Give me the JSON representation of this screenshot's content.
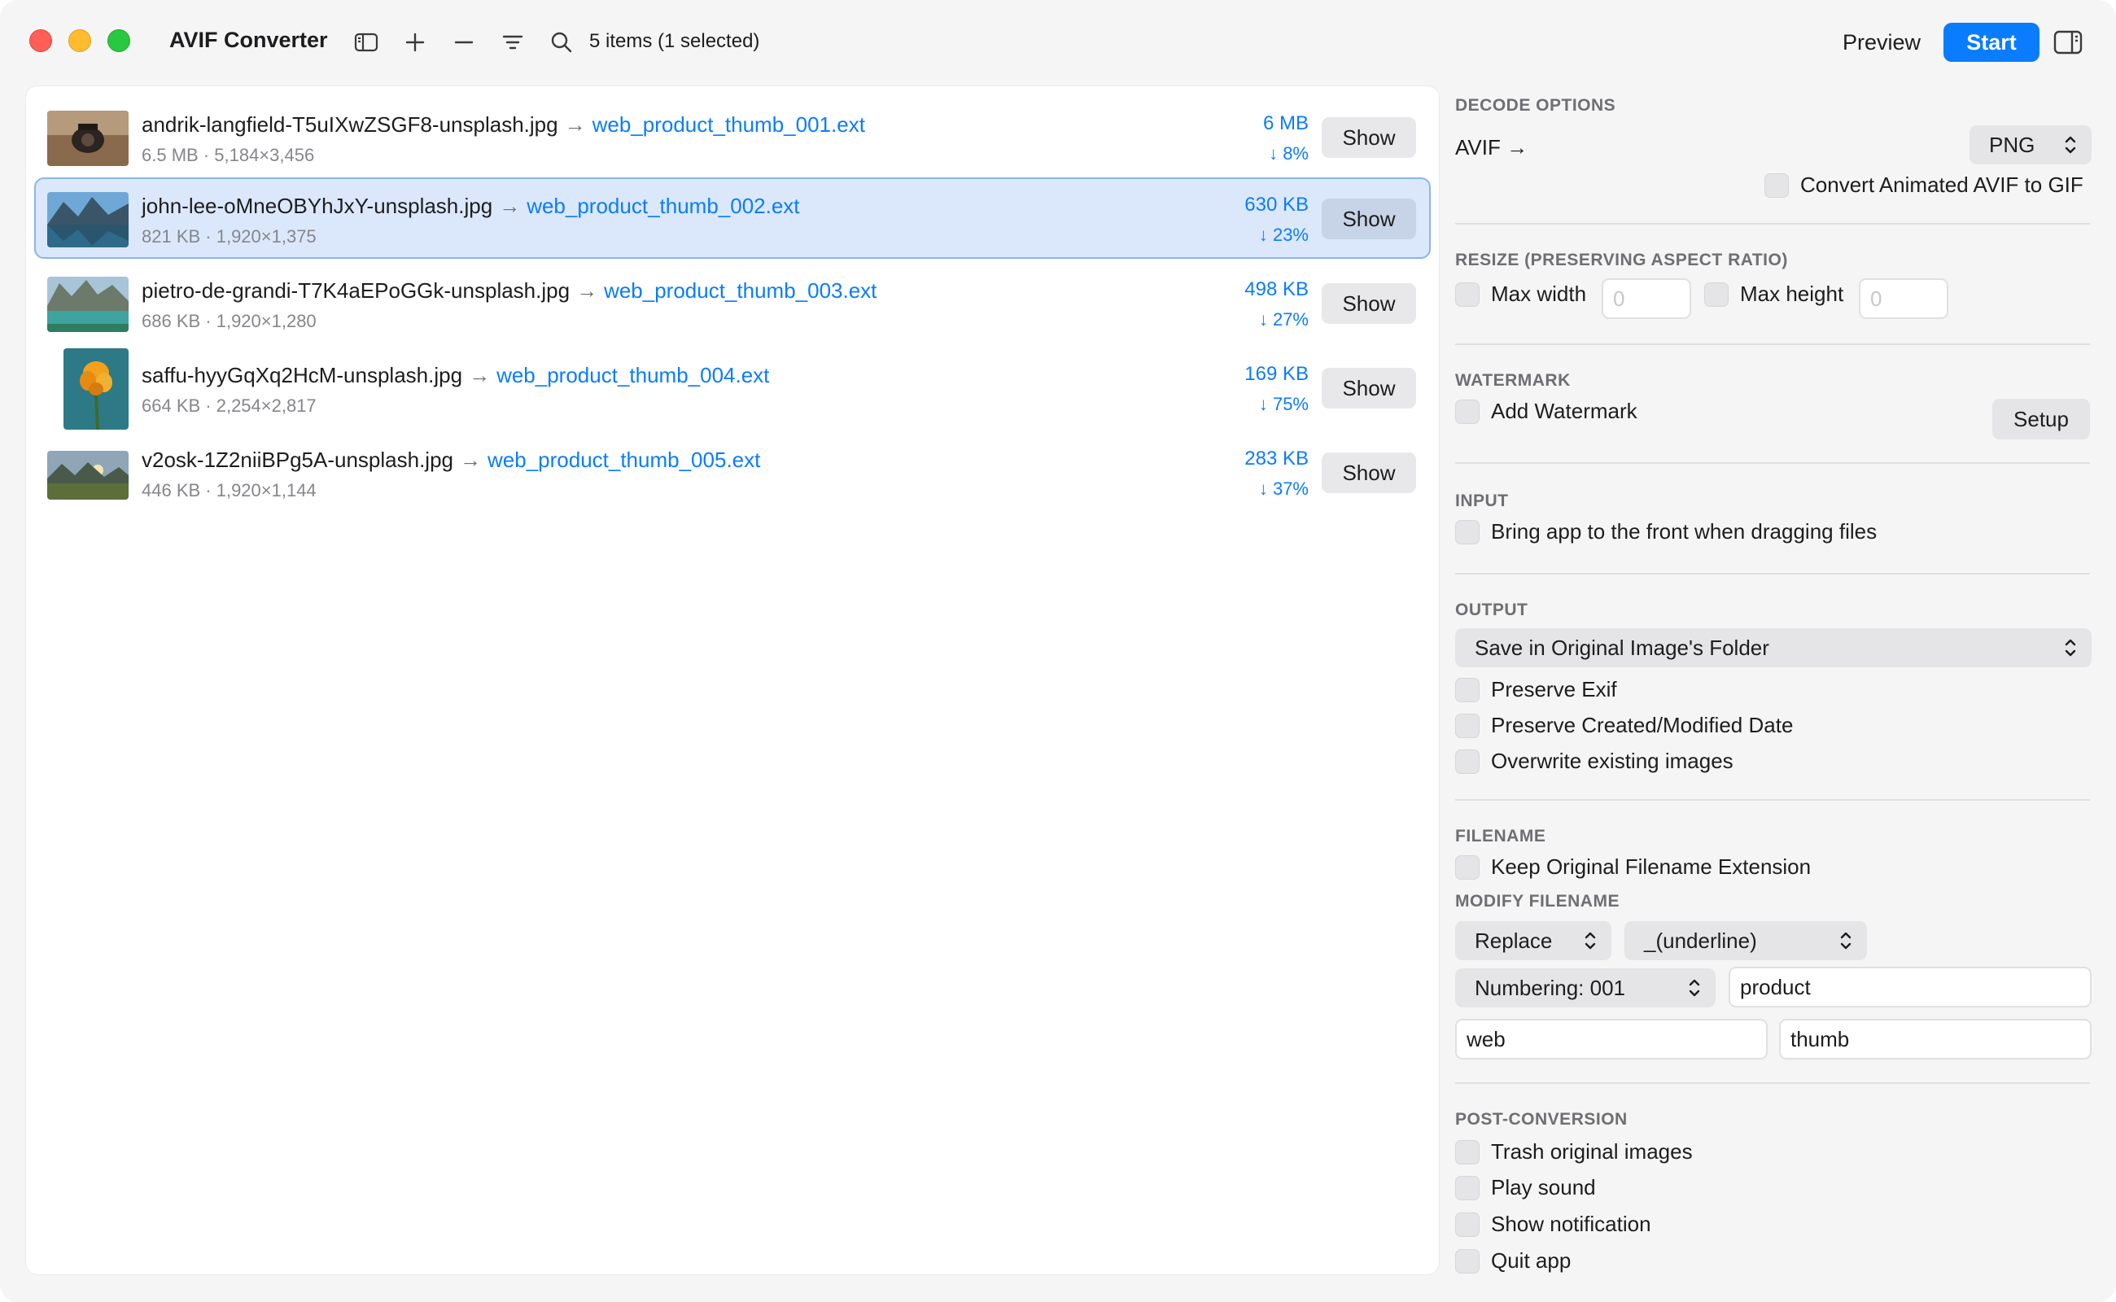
{
  "window": {
    "title": "AVIF Converter",
    "items_count": "5 items (1 selected)",
    "preview_label": "Preview",
    "start_label": "Start"
  },
  "toolbar_icons": [
    "sidebar-left-icon",
    "plus-icon",
    "minus-icon",
    "list-filter-icon",
    "search-icon",
    "sidebar-right-icon"
  ],
  "files": [
    {
      "name": "andrik-langfield-T5uIXwZSGF8-unsplash.jpg",
      "output": "web_product_thumb_001.ext",
      "meta": "6.5 MB · 5,184×3,456",
      "size": "6 MB",
      "pct": "↓ 8%",
      "show": "Show",
      "selected": false
    },
    {
      "name": "john-lee-oMneOBYhJxY-unsplash.jpg",
      "output": "web_product_thumb_002.ext",
      "meta": "821 KB · 1,920×1,375",
      "size": "630 KB",
      "pct": "↓ 23%",
      "show": "Show",
      "selected": true
    },
    {
      "name": "pietro-de-grandi-T7K4aEPoGGk-unsplash.jpg",
      "output": "web_product_thumb_003.ext",
      "meta": "686 KB · 1,920×1,280",
      "size": "498 KB",
      "pct": "↓ 27%",
      "show": "Show",
      "selected": false
    },
    {
      "name": "saffu-hyyGqXq2HcM-unsplash.jpg",
      "output": "web_product_thumb_004.ext",
      "meta": "664 KB · 2,254×2,817",
      "size": "169 KB",
      "pct": "↓ 75%",
      "show": "Show",
      "selected": false
    },
    {
      "name": "v2osk-1Z2niiBPg5A-unsplash.jpg",
      "output": "web_product_thumb_005.ext",
      "meta": "446 KB · 1,920×1,144",
      "size": "283 KB",
      "pct": "↓ 37%",
      "show": "Show",
      "selected": false
    }
  ],
  "arrow_glyph": "→",
  "settings": {
    "decode": {
      "title": "DECODE OPTIONS",
      "input_label": "AVIF",
      "arrow": "→",
      "format": "PNG",
      "animated_label": "Convert Animated AVIF to GIF"
    },
    "resize": {
      "title": "RESIZE (PRESERVING ASPECT RATIO)",
      "max_width_label": "Max width",
      "max_width_placeholder": "0",
      "max_height_label": "Max height",
      "max_height_placeholder": "0"
    },
    "watermark": {
      "title": "WATERMARK",
      "add_label": "Add Watermark",
      "setup_label": "Setup"
    },
    "input": {
      "title": "INPUT",
      "front_label": "Bring app to the front when dragging files"
    },
    "output": {
      "title": "OUTPUT",
      "location": "Save in Original Image's Folder",
      "exif_label": "Preserve Exif",
      "dates_label": "Preserve Created/Modified Date",
      "overwrite_label": "Overwrite existing images"
    },
    "filename": {
      "title": "FILENAME",
      "keep_ext_label": "Keep Original Filename Extension",
      "modify_title": "MODIFY FILENAME",
      "mode": "Replace",
      "separator": "_(underline)",
      "numbering": "Numbering: 001",
      "field_product": "product",
      "field_web": "web",
      "field_thumb": "thumb"
    },
    "post": {
      "title": "POST-CONVERSION",
      "trash_label": "Trash original images",
      "sound_label": "Play sound",
      "notify_label": "Show notification",
      "quit_label": "Quit app"
    }
  },
  "colors": {
    "accent": "#0a7cff",
    "selection_bg": "#dbe8fc"
  }
}
